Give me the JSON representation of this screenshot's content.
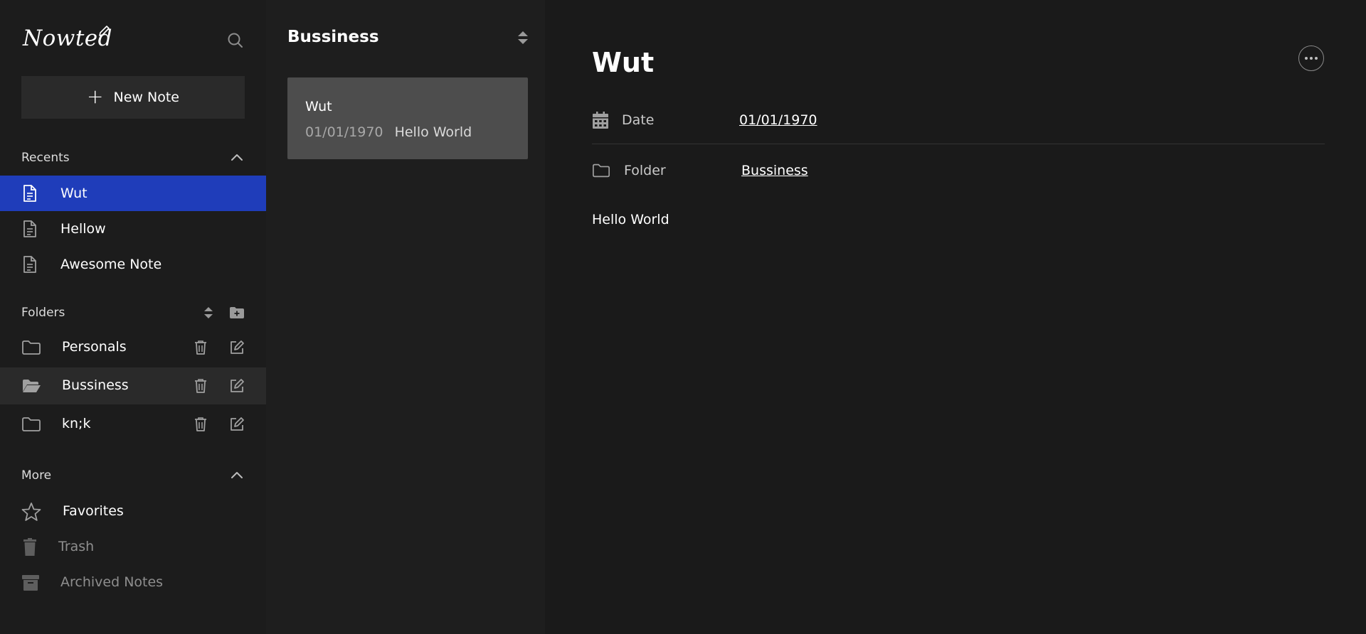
{
  "app": {
    "logo_text": "Nowted"
  },
  "sidebar": {
    "new_note_label": "New Note",
    "recents_label": "Recents",
    "recents": [
      {
        "label": "Wut",
        "active": true
      },
      {
        "label": "Hellow",
        "active": false
      },
      {
        "label": "Awesome Note",
        "active": false
      }
    ],
    "folders_label": "Folders",
    "folders": [
      {
        "label": "Personals",
        "active": false
      },
      {
        "label": "Bussiness",
        "active": true
      },
      {
        "label": "kn;k",
        "active": false
      }
    ],
    "more_label": "More",
    "more": [
      {
        "label": "Favorites",
        "icon": "star-icon"
      },
      {
        "label": "Trash",
        "icon": "trash-icon"
      },
      {
        "label": "Archived Notes",
        "icon": "archive-icon"
      }
    ]
  },
  "notes_list": {
    "folder_title": "Bussiness",
    "notes": [
      {
        "title": "Wut",
        "date": "01/01/1970",
        "preview": "Hello World"
      }
    ]
  },
  "editor": {
    "title": "Wut",
    "date_label": "Date",
    "date_value": "01/01/1970",
    "folder_label": "Folder",
    "folder_value": "Bussiness",
    "body": "Hello World"
  },
  "colors": {
    "accent": "#1f3dba",
    "sidebar_bg": "#1c1c1c",
    "list_bg": "#1e1e1e",
    "editor_bg": "#1a1a1a",
    "card_bg": "#4d4d4d"
  }
}
